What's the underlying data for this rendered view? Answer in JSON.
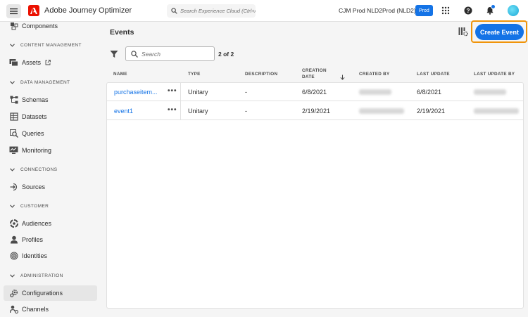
{
  "header": {
    "app_title": "Adobe Journey Optimizer",
    "search_placeholder": "Search Experience Cloud (Ctrl+/)",
    "org": "CJM Prod NLD2",
    "sandbox": "Prod (NLD2)",
    "sandbox_badge": "Prod",
    "icons": [
      "menu-icon",
      "adobe-logo-icon",
      "apps-grid-icon",
      "help-icon",
      "notifications-icon",
      "avatar"
    ],
    "brand_color": "#eb1000",
    "accent_color": "#1473e6"
  },
  "sidebar": {
    "sections": {
      "content_management": "CONTENT MANAGEMENT",
      "data_management": "DATA MANAGEMENT",
      "connections": "CONNECTIONS",
      "customer": "CUSTOMER",
      "administration": "ADMINISTRATION"
    },
    "items": {
      "components": "Components",
      "assets": "Assets",
      "schemas": "Schemas",
      "datasets": "Datasets",
      "queries": "Queries",
      "monitoring": "Monitoring",
      "sources": "Sources",
      "audiences": "Audiences",
      "profiles": "Profiles",
      "identities": "Identities",
      "configurations": "Configurations",
      "channels": "Channels"
    },
    "active_item": "Configurations"
  },
  "main": {
    "title": "Events",
    "create_button": "Create Event",
    "search_placeholder": "Search",
    "count": "2 of 2",
    "columns": {
      "name": "NAME",
      "type": "TYPE",
      "description": "DESCRIPTION",
      "creation_date_1": "CREATION",
      "creation_date_2": "DATE",
      "created_by": "CREATED BY",
      "last_update": "LAST UPDATE",
      "last_update_by": "LAST UPDATE BY"
    },
    "rows": [
      {
        "name": "purchaseitem...",
        "more": "•••",
        "type": "Unitary",
        "description": "-",
        "creation_date": "6/8/2021",
        "last_update": "6/8/2021"
      },
      {
        "name": "event1",
        "more": "•••",
        "type": "Unitary",
        "description": "-",
        "creation_date": "2/19/2021",
        "last_update": "2/19/2021"
      }
    ],
    "highlight_color": "#f0940a"
  }
}
